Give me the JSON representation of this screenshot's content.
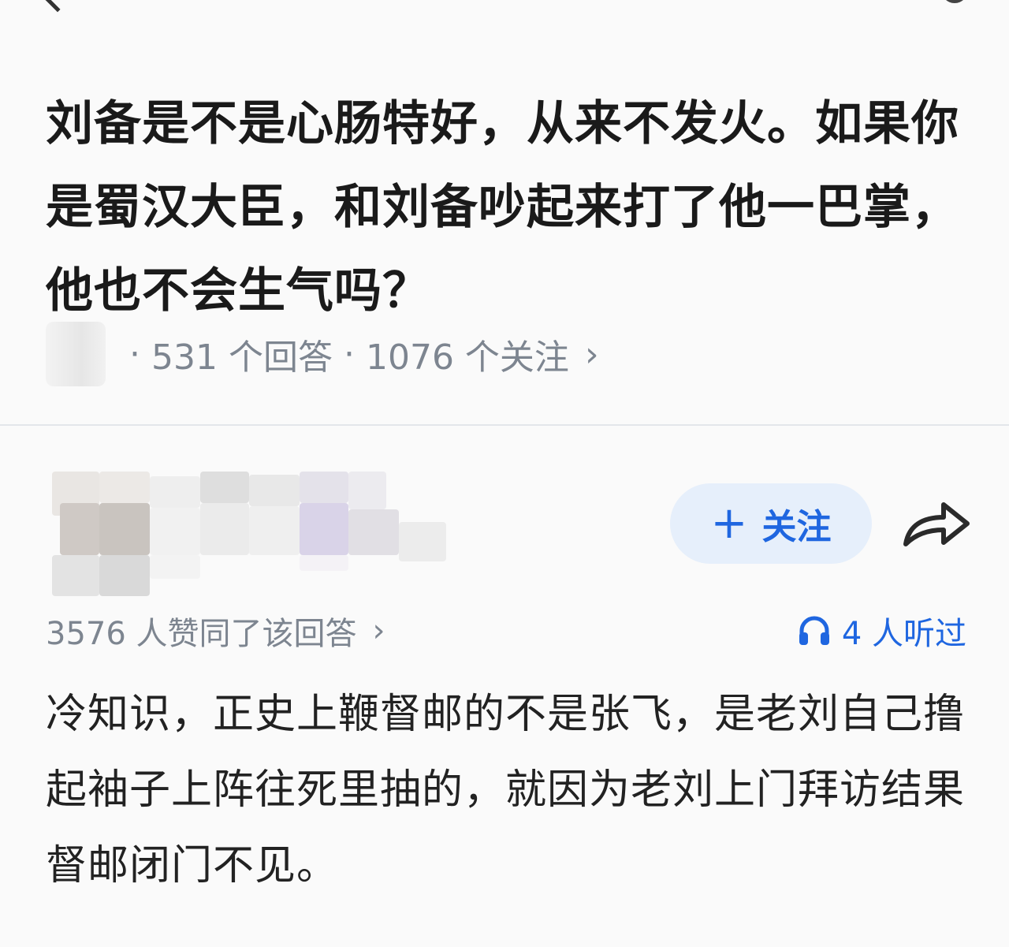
{
  "question": {
    "title": "刘备是不是心肠特好，从来不发火。如果你是蜀汉大臣，和刘备吵起来打了他一巴掌，他也不会生气吗？",
    "answers_count": "531 个回答",
    "followers_count": "1076 个关注"
  },
  "answer": {
    "follow_label": "关注",
    "agree_text": "3576 人赞同了该回答",
    "listened_text": "4 人听过",
    "body": "冷知识，正史上鞭督邮的不是张飞，是老刘自己撸起袖子上阵往死里抽的，就因为老刘上门拜访结果督邮闭门不见。"
  },
  "icons": {
    "back": "back-chevron-icon",
    "search": "search-icon",
    "share": "share-arrow-icon",
    "headphones": "headphones-icon",
    "chevron": "chevron-right-icon"
  },
  "colors": {
    "accent": "#1f66e0",
    "follow_bg": "#e6effb",
    "meta": "#7d8590"
  }
}
